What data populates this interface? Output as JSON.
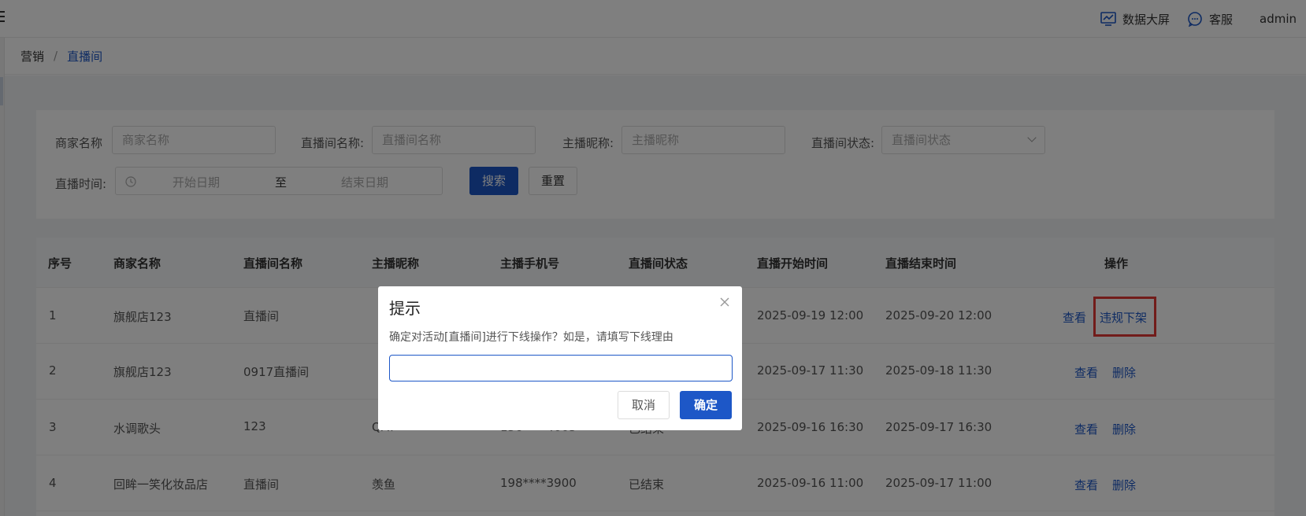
{
  "header": {
    "data_screen_label": "数据大屏",
    "service_label": "客服",
    "user_name": "admin"
  },
  "breadcrumb": {
    "parent": "营销",
    "separator": "/",
    "current": "直播间"
  },
  "filters": {
    "merchant_label": "商家名称",
    "merchant_placeholder": "商家名称",
    "room_label": "直播间名称:",
    "room_placeholder": "直播间名称",
    "anchor_label": "主播昵称:",
    "anchor_placeholder": "主播昵称",
    "status_label": "直播间状态:",
    "status_placeholder": "直播间状态",
    "time_label": "直播时间:",
    "start_placeholder": "开始日期",
    "range_sep": "至",
    "end_placeholder": "结束日期",
    "search_button": "搜索",
    "reset_button": "重置"
  },
  "table": {
    "columns": [
      "序号",
      "商家名称",
      "直播间名称",
      "主播昵称",
      "主播手机号",
      "直播间状态",
      "直播开始时间",
      "直播结束时间",
      "操作"
    ],
    "rows": [
      {
        "index": "1",
        "merchant": "旗舰店123",
        "room": "直播间",
        "anchor": "",
        "phone": "",
        "status": "",
        "start": "2025-09-19 12:00",
        "end": "2025-09-20 12:00",
        "actions": [
          "查看",
          "违规下架"
        ]
      },
      {
        "index": "2",
        "merchant": "旗舰店123",
        "room": "0917直播间",
        "anchor": "",
        "phone": "",
        "status": "",
        "start": "2025-09-17 11:30",
        "end": "2025-09-18 11:30",
        "actions": [
          "查看",
          "删除"
        ]
      },
      {
        "index": "3",
        "merchant": "水调歌头",
        "room": "123",
        "anchor": "QAT",
        "phone": "156****4005",
        "status": "已结束",
        "start": "2025-09-16 16:30",
        "end": "2025-09-17 16:30",
        "actions": [
          "查看",
          "删除"
        ]
      },
      {
        "index": "4",
        "merchant": "回眸一笑化妆品店",
        "room": "直播间",
        "anchor": "羡鱼",
        "phone": "198****3900",
        "status": "已结束",
        "start": "2025-09-16 11:00",
        "end": "2025-09-17 11:00",
        "actions": [
          "查看",
          "删除"
        ]
      }
    ]
  },
  "dialog": {
    "title": "提示",
    "message": "确定对活动[直播间]进行下线操作？如是，请填写下线理由",
    "input_value": "",
    "cancel_label": "取消",
    "confirm_label": "确定"
  },
  "colors": {
    "primary": "#1d57c7",
    "highlight_box": "#e53935"
  }
}
